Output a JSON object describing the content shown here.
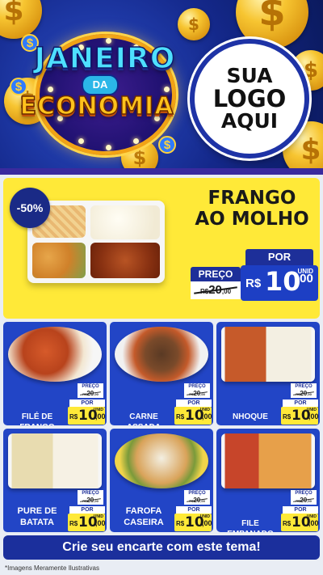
{
  "header": {
    "title_line1": "JANEIRO",
    "title_line2": "DA",
    "title_line3": "ECONOMIA",
    "logo_line1": "SUA",
    "logo_line2": "LOGO",
    "logo_line3": "AQUI",
    "dollar_symbol": "$"
  },
  "hero": {
    "discount": "-50%",
    "name_line1": "FRANGO",
    "name_line2": "AO MOLHO",
    "preco_label": "PREÇO",
    "old_currency": "R$",
    "old_int": "20",
    "old_cents": ",00",
    "por_label": "POR",
    "unid_label": "UNID",
    "new_currency": "R$",
    "new_int": "10",
    "new_cents": ",00"
  },
  "products": [
    {
      "name": "FILÉ DE FRANGO",
      "preco_label": "PREÇO",
      "old_currency": "R$",
      "old_int": "20",
      "old_cents": ",00",
      "por_label": "POR",
      "new_currency": "R$",
      "new_int": "10",
      "new_cents": ",00",
      "unid_label": "UNID"
    },
    {
      "name": "CARNE ASSADA",
      "preco_label": "PREÇO",
      "old_currency": "R$",
      "old_int": "20",
      "old_cents": ",00",
      "por_label": "POR",
      "new_currency": "R$",
      "new_int": "10",
      "new_cents": ",00",
      "unid_label": "UNID"
    },
    {
      "name": "NHOQUE",
      "preco_label": "PREÇO",
      "old_currency": "R$",
      "old_int": "20",
      "old_cents": ",00",
      "por_label": "POR",
      "new_currency": "R$",
      "new_int": "10",
      "new_cents": ",00",
      "unid_label": "UNID"
    },
    {
      "name": "PURE DE BATATA",
      "preco_label": "PREÇO",
      "old_currency": "R$",
      "old_int": "20",
      "old_cents": ",00",
      "por_label": "POR",
      "new_currency": "R$",
      "new_int": "10",
      "new_cents": ",00",
      "unid_label": "UNID"
    },
    {
      "name": "FAROFA CASEIRA",
      "preco_label": "PREÇO",
      "old_currency": "R$",
      "old_int": "20",
      "old_cents": ",00",
      "por_label": "POR",
      "new_currency": "R$",
      "new_int": "10",
      "new_cents": ",00",
      "unid_label": "UNID"
    },
    {
      "name": "FILE EMPANADO",
      "preco_label": "PREÇO",
      "old_currency": "R$",
      "old_int": "20",
      "old_cents": ",00",
      "por_label": "POR",
      "new_currency": "R$",
      "new_int": "10",
      "new_cents": ",00",
      "unid_label": "UNID"
    }
  ],
  "footer": {
    "cta": "Crie seu encarte com este tema!",
    "disclaimer": "*Imagens Meramente Ilustrativas"
  },
  "colors": {
    "header_blue": "#14288a",
    "card_blue": "#2245c6",
    "price_yellow": "#ffe938",
    "cta_blue": "#1b2f9c"
  }
}
